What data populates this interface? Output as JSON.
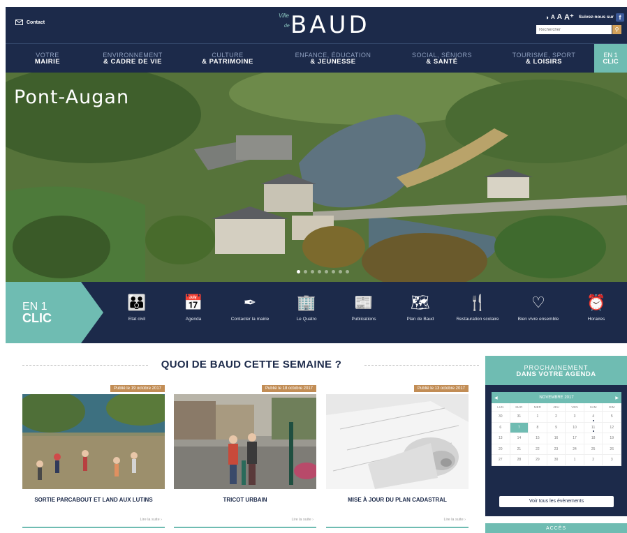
{
  "header": {
    "contact_label": "Contact",
    "logo": {
      "ville": "Ville",
      "de": "de",
      "word": "BAUD"
    },
    "contrast_label": "◑",
    "font_sizes": [
      "A",
      "A",
      "A⁺"
    ],
    "follow_label": "Suivez-nous sur",
    "facebook_label": "f",
    "search_placeholder": "Rechercher"
  },
  "nav": [
    {
      "line1": "VOTRE",
      "line2": "MAIRIE"
    },
    {
      "line1": "ENVIRONNEMENT",
      "line2": "& CADRE DE VIE"
    },
    {
      "line1": "CULTURE",
      "line2": "& PATRIMOINE"
    },
    {
      "line1": "ENFANCE, ÉDUCATION",
      "line2": "& JEUNESSE"
    },
    {
      "line1": "SOCIAL, SÉNIORS",
      "line2": "& SANTÉ"
    },
    {
      "line1": "TOURISME, SPORT",
      "line2": "& LOISIRS"
    },
    {
      "line1": "EN 1",
      "line2": "CLIC"
    }
  ],
  "hero": {
    "title": "Pont-Augan",
    "slide_count": 8,
    "active_slide": 1
  },
  "quick": {
    "badge_line1": "EN 1",
    "badge_line2": "CLIC",
    "items": [
      {
        "icon": "family-icon",
        "glyph": "👪",
        "label": "Etat civil"
      },
      {
        "icon": "calendar-icon",
        "glyph": "📅",
        "label": "Agenda"
      },
      {
        "icon": "pen-icon",
        "glyph": "✒",
        "label": "Contacter la mairie"
      },
      {
        "icon": "building-icon",
        "glyph": "🏢",
        "label": "Le Quatro"
      },
      {
        "icon": "newspaper-icon",
        "glyph": "📰",
        "label": "Publications"
      },
      {
        "icon": "map-pin-icon",
        "glyph": "🗺",
        "label": "Plan de Baud"
      },
      {
        "icon": "fork-knife-icon",
        "glyph": "🍴",
        "label": "Restauration scolaire"
      },
      {
        "icon": "heart-icon",
        "glyph": "♡",
        "label": "Bien vivre ensemble"
      },
      {
        "icon": "clock-icon",
        "glyph": "⏰",
        "label": "Horaires"
      }
    ]
  },
  "news": {
    "section_title": "QUOI DE BAUD CETTE SEMAINE ?",
    "read_more": "Lire la suite ›",
    "cards": [
      {
        "date": "Publié le 19 octobre 2017",
        "title": "SORTIE PARCABOUT ET LAND AUX LUTINS"
      },
      {
        "date": "Publié le 18 octobre 2017",
        "title": "TRICOT URBAIN"
      },
      {
        "date": "Publié le 13 octobre 2017",
        "title": "MISE À JOUR DU PLAN CADASTRAL"
      }
    ]
  },
  "agenda": {
    "title_line1": "PROCHAINEMENT",
    "title_line2": "DANS VOTRE AGENDA",
    "month": "NOVEMBRE 2017",
    "prev": "◀",
    "next": "▶",
    "weekdays": [
      "LUN",
      "MAR",
      "MER",
      "JEU",
      "VEN",
      "SAM",
      "DIM"
    ],
    "days": [
      "30",
      "31",
      "1",
      "2",
      "3",
      "4",
      "5",
      "6",
      "7",
      "8",
      "9",
      "10",
      "11",
      "12",
      "13",
      "14",
      "15",
      "16",
      "17",
      "18",
      "19",
      "20",
      "21",
      "22",
      "23",
      "24",
      "25",
      "26",
      "27",
      "28",
      "29",
      "30",
      "1",
      "2",
      "3"
    ],
    "today": "7",
    "event_days": [
      "4",
      "11"
    ],
    "all_events_label": "Voir tous les évènements"
  },
  "acces": {
    "label": "ACCÈS"
  }
}
